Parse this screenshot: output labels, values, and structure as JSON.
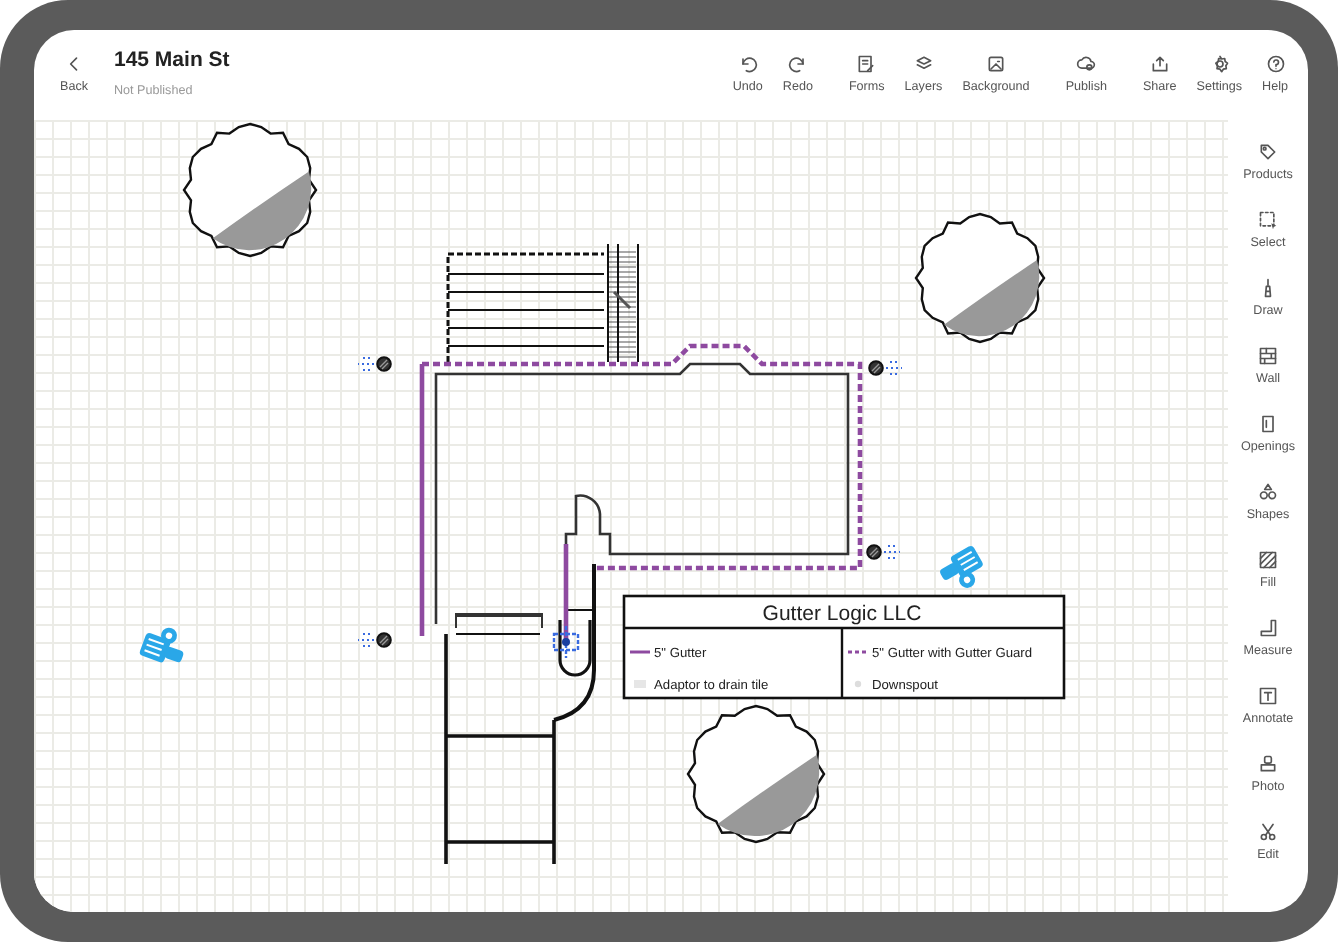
{
  "header": {
    "back": "Back",
    "title": "145 Main St",
    "subtitle": "Not Published"
  },
  "toolbar": [
    {
      "label": "Undo"
    },
    {
      "label": "Redo"
    },
    {
      "label": "Forms"
    },
    {
      "label": "Layers"
    },
    {
      "label": "Background"
    },
    {
      "label": "Publish"
    },
    {
      "label": "Share"
    },
    {
      "label": "Settings"
    },
    {
      "label": "Help"
    }
  ],
  "side_toolbar": [
    {
      "label": "Products"
    },
    {
      "label": "Select"
    },
    {
      "label": "Draw"
    },
    {
      "label": "Wall"
    },
    {
      "label": "Openings"
    },
    {
      "label": "Shapes"
    },
    {
      "label": "Fill"
    },
    {
      "label": "Measure"
    },
    {
      "label": "Annotate"
    },
    {
      "label": "Photo"
    },
    {
      "label": "Edit"
    }
  ],
  "legend": {
    "title": "Gutter Logic LLC",
    "items": [
      {
        "kind": "solid-line",
        "label": "5\" Gutter"
      },
      {
        "kind": "dashed-line",
        "label": "5\" Gutter with Gutter Guard"
      },
      {
        "kind": "adaptor",
        "label": "Adaptor to drain tile"
      },
      {
        "kind": "downspout",
        "label": "Downspout"
      }
    ]
  }
}
